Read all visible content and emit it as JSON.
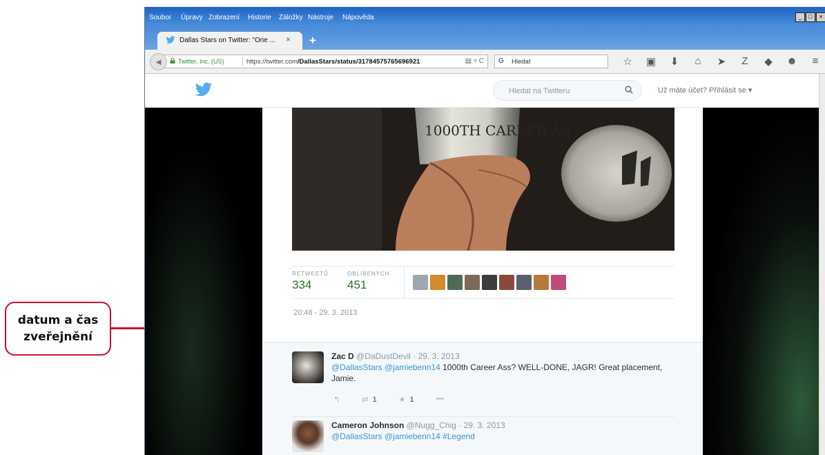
{
  "callout": {
    "line1": "datum a čas",
    "line2": "zveřejnění",
    "color": "#c8102e"
  },
  "menu": [
    "Soubor",
    "Úpravy",
    "Zobrazení",
    "Historie",
    "Záložky",
    "Nástroje",
    "Nápověda"
  ],
  "tab": {
    "title": "Dallas Stars on Twitter: \"One ...",
    "close": "×",
    "new_tab": "+"
  },
  "urlbar": {
    "identity": "Twitter, Inc. (US)",
    "url_host": "https://twitter.com",
    "url_path": "/DallasStars/status/3178457576569692​1",
    "reload": "C"
  },
  "searchbar": {
    "placeholder": "Hledat"
  },
  "twitter": {
    "search_placeholder": "Hledat na Twitteru",
    "login": "Už máte účet? Přihlásit se ▾",
    "brand_color": "#55acee"
  },
  "tweet": {
    "photo_text": "1000TH CAREER AS",
    "retweets_label": "RETWEETŮ",
    "retweets": "334",
    "favorites_label": "OBLÍBENÝCH",
    "favorites": "451",
    "timestamp": "20:48 - 29. 3. 2013"
  },
  "replies": [
    {
      "name": "Zac D",
      "meta": "@DaDustDevil · 29. 3. 2013",
      "mention1": "@DallasStars",
      "mention2": "@jamiebenn14",
      "text": " 1000th Career Ass?  WELL-DONE, JAGR! Great placement, Jamie.",
      "retweets": "1",
      "favorites": "1",
      "more": "•••"
    },
    {
      "name": "Cameron Johnson",
      "meta": "@Nugg_Chig · 29. 3. 2013",
      "mention1": "@DallasStars",
      "mention2": "@jamiebenn14",
      "text": " #Legend"
    }
  ]
}
